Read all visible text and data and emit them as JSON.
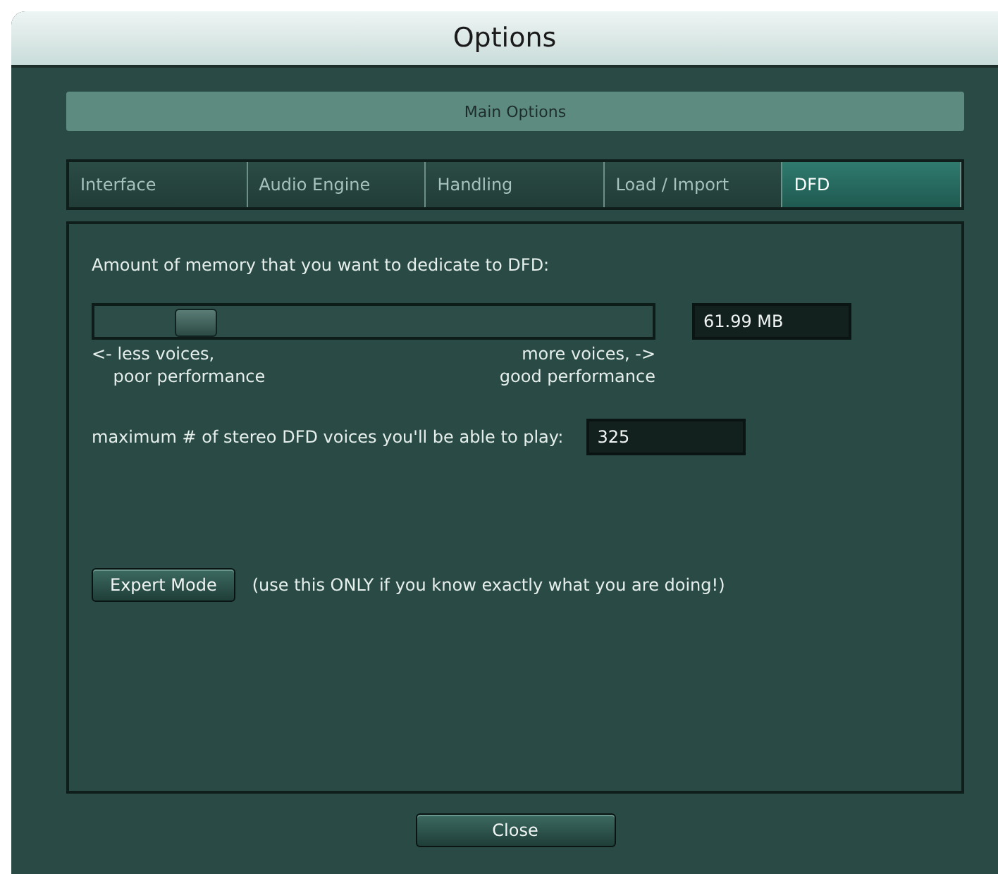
{
  "window": {
    "title": "Options"
  },
  "section_header": "Main Options",
  "tabs": [
    {
      "label": "Interface",
      "selected": false
    },
    {
      "label": "Audio Engine",
      "selected": false
    },
    {
      "label": "Handling",
      "selected": false
    },
    {
      "label": "Load / Import",
      "selected": false
    },
    {
      "label": "DFD",
      "selected": true
    }
  ],
  "memory": {
    "label": "Amount of memory that you want to dedicate to DFD:",
    "level": 0.15,
    "value": "61.99 MB",
    "left_hint": [
      "<- less voices,",
      "poor performance"
    ],
    "right_hint": [
      "more voices, ->",
      "good performance"
    ]
  },
  "voices": {
    "label": "maximum # of stereo DFD voices you'll be able to play:",
    "value": "325"
  },
  "expert": {
    "button": "Expert Mode",
    "note": "(use this ONLY if you know exactly what you are doing!)"
  },
  "buttons": [
    "Close"
  ]
}
